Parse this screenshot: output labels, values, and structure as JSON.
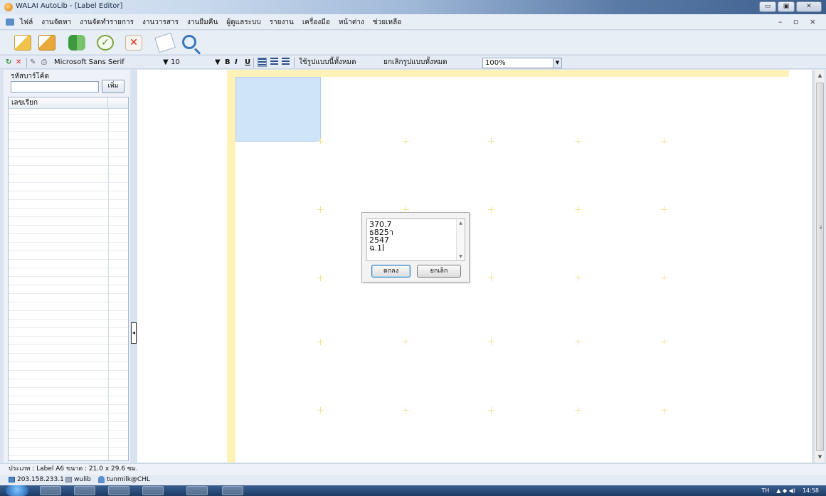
{
  "window": {
    "title": "WALAI AutoLib - [Label Editor]",
    "controls": [
      "▭",
      "▣",
      "✕"
    ]
  },
  "menu": {
    "items": [
      "ไฟล์",
      "งานจัดหา",
      "งานจัดทำรายการ",
      "งานวารสาร",
      "งานยืมคืน",
      "ผู้ดูแลระบบ",
      "รายงาน",
      "เครื่องมือ",
      "หน้าต่าง",
      "ช่วยเหลือ"
    ],
    "mdi_controls": "– ▫ ×"
  },
  "format_toolbar": {
    "font": "Microsoft Sans Serif",
    "size": "10",
    "bold": "B",
    "italic": "I",
    "underline": "U",
    "apply_all": "ใช้รูปแบบนี้ทั้งหมด",
    "cancel_all": "ยกเลิกรูปแบบทั้งหมด",
    "zoom": "100%"
  },
  "left_panel": {
    "barcode_label": "รหัสบาร์โค้ด",
    "barcode_value": "",
    "add_button": "เพิ่ม",
    "column_header": "เลขเรียก"
  },
  "dialog": {
    "lines": [
      "370.7",
      "ธ825า",
      "2547",
      "ฉ.1"
    ],
    "ok": "ตกลง",
    "cancel": "ยกเลิก"
  },
  "status": {
    "page_info": "ประเภท : Label A6  ขนาด : 21.0 x 29.6 ซม.",
    "ip": "203.158.233.1",
    "db": "wulib",
    "user": "tunmilk@CHL"
  },
  "taskbar": {
    "lang": "TH",
    "time": "14:58"
  }
}
